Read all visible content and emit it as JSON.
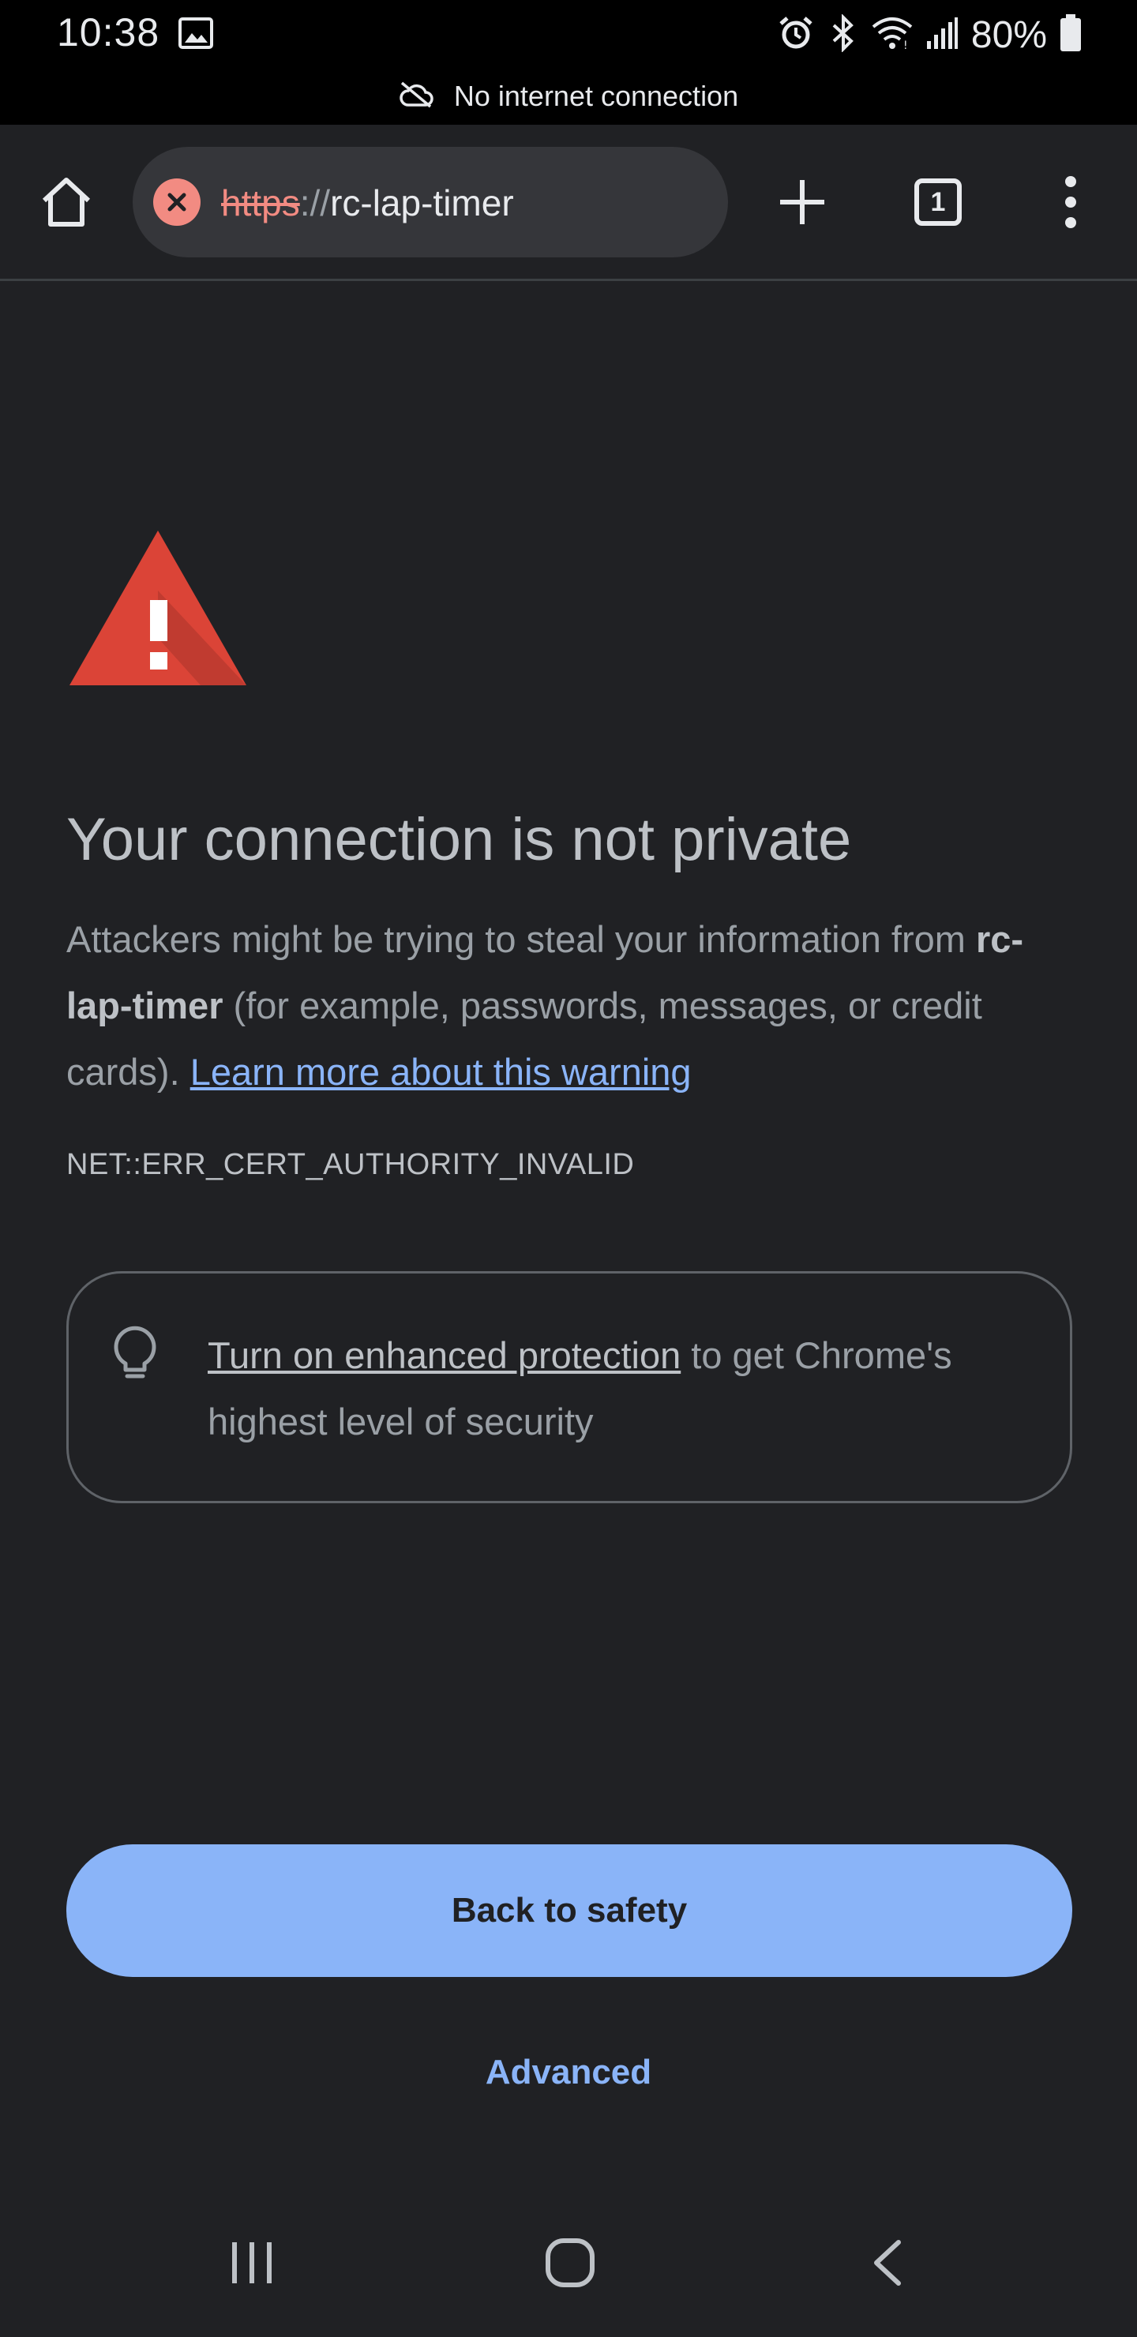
{
  "status_bar": {
    "time": "10:38",
    "battery": "80%",
    "icons": [
      "gallery-icon",
      "alarm-icon",
      "bluetooth-icon",
      "wifi-icon",
      "signal-icon",
      "battery-icon"
    ],
    "offline_notice": "No internet connection"
  },
  "toolbar": {
    "url_scheme": "https",
    "url_separator": "://",
    "url_host": "rc-lap-timer",
    "tab_count": "1"
  },
  "page": {
    "heading": "Your connection is not private",
    "body_intro": "Attackers might be trying to steal your information from ",
    "body_site": "rc-lap-timer",
    "body_rest": " (for example, passwords, messages, or credit cards). ",
    "learn_more_link": "Learn more about this warning",
    "error_code": "NET::ERR_CERT_AUTHORITY_INVALID",
    "enhanced_link": "Turn on enhanced protection",
    "enhanced_rest": " to get Chrome's highest level of security",
    "back_button": "Back to safety",
    "advanced_link": "Advanced"
  },
  "colors": {
    "background": "#202124",
    "accent_blue": "#8ab4f8",
    "warning_red": "#db4437",
    "insecure_red": "#f28b82"
  }
}
